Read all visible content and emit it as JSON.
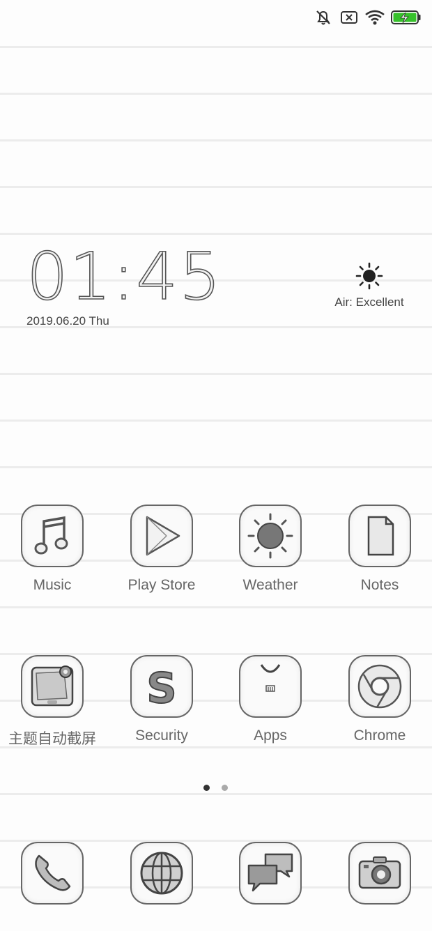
{
  "status_bar": {
    "icons": [
      "mute-bell-icon",
      "no-sim-icon",
      "wifi-icon",
      "battery-charging-icon"
    ]
  },
  "clock_widget": {
    "time": "01:45",
    "date": "2019.06.20 Thu"
  },
  "weather_widget": {
    "icon": "sun-icon",
    "air_quality": "Air: Excellent"
  },
  "home_apps": [
    {
      "label": "Music",
      "icon": "music-note-icon"
    },
    {
      "label": "Play Store",
      "icon": "play-store-icon"
    },
    {
      "label": "Weather",
      "icon": "weather-sun-icon"
    },
    {
      "label": "Notes",
      "icon": "notes-icon"
    },
    {
      "label": "主题自动截屏",
      "icon": "theme-screenshot-icon"
    },
    {
      "label": "Security",
      "icon": "security-shield-icon"
    },
    {
      "label": "Apps",
      "icon": "mi-apps-bag-icon"
    },
    {
      "label": "Chrome",
      "icon": "chrome-icon"
    }
  ],
  "page_indicator": {
    "pages": 2,
    "current": 1
  },
  "dock": [
    {
      "icon": "phone-icon"
    },
    {
      "icon": "browser-globe-icon"
    },
    {
      "icon": "messages-icon"
    },
    {
      "icon": "camera-icon"
    }
  ],
  "colors": {
    "line": "#ececec",
    "stroke": "#555555",
    "background": "#fdfdfd"
  }
}
